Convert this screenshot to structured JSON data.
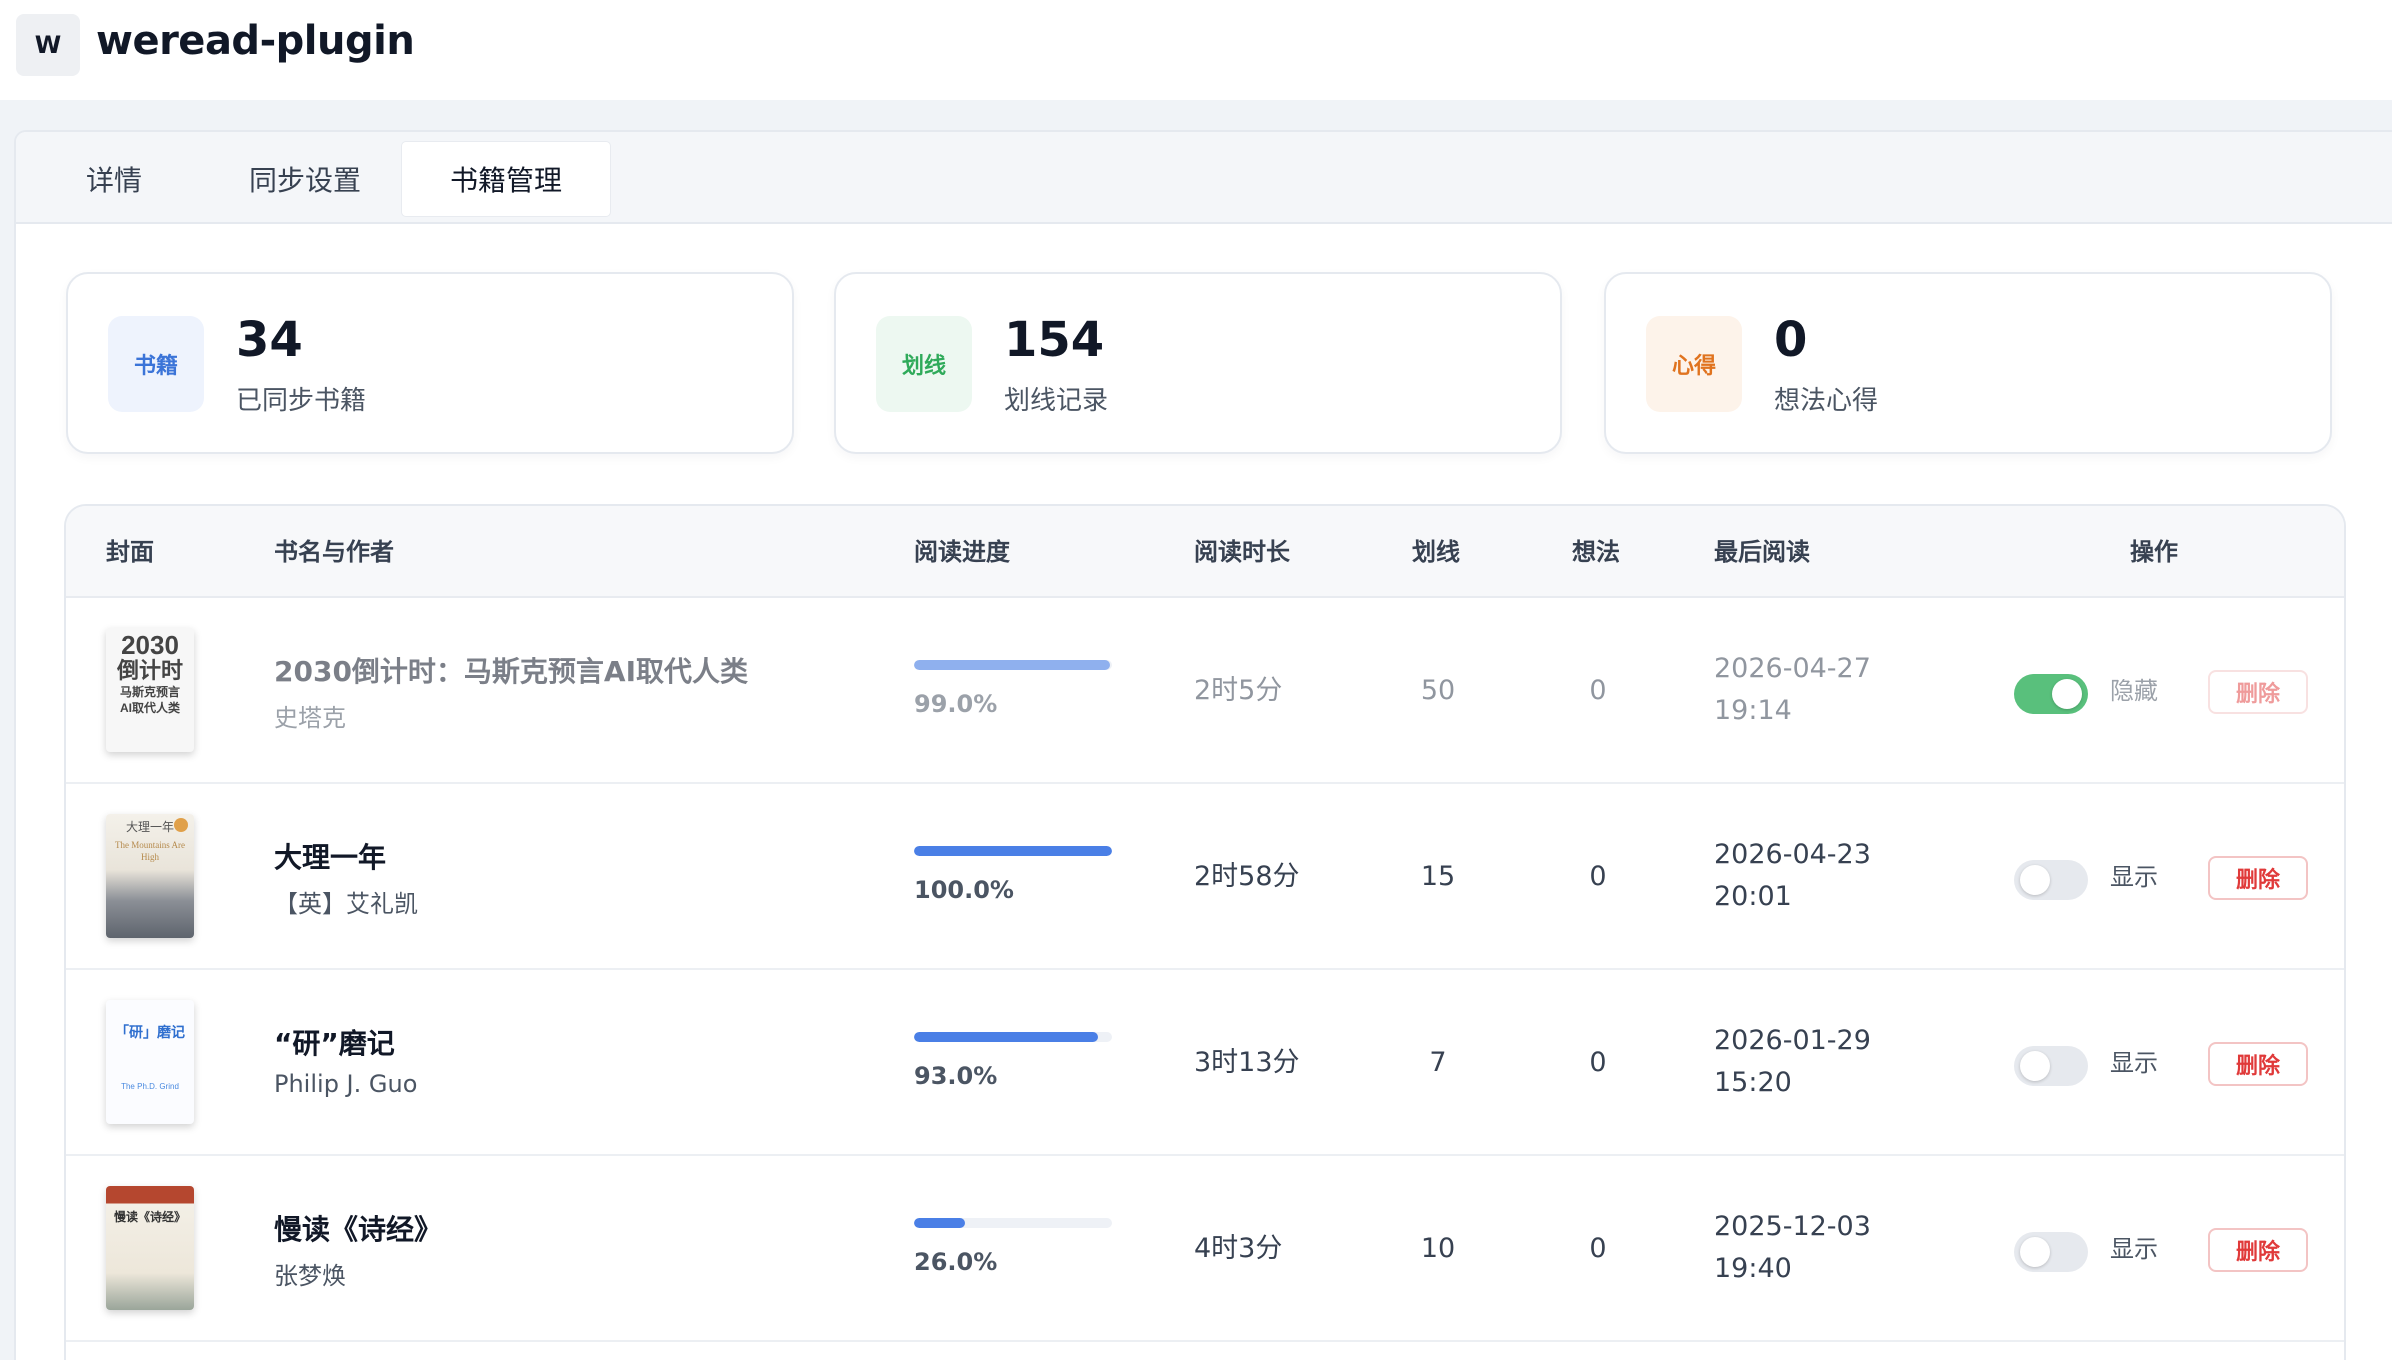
{
  "app": {
    "icon_letter": "W",
    "title": "weread-plugin"
  },
  "tabs": [
    {
      "label": "详情",
      "active": false
    },
    {
      "label": "同步设置",
      "active": false
    },
    {
      "label": "书籍管理",
      "active": true
    }
  ],
  "stats": [
    {
      "icon_text": "书籍",
      "value": "34",
      "label": "已同步书籍",
      "color": "#3b74d8",
      "bg": "#eef3fd"
    },
    {
      "icon_text": "划线",
      "value": "154",
      "label": "划线记录",
      "color": "#2faa5a",
      "bg": "#edf8f1"
    },
    {
      "icon_text": "心得",
      "value": "0",
      "label": "想法心得",
      "color": "#e0731f",
      "bg": "#fdf3ea"
    }
  ],
  "table": {
    "headers": {
      "cover": "封面",
      "title_author": "书名与作者",
      "progress": "阅读进度",
      "duration": "阅读时长",
      "highlights": "划线",
      "notes": "想法",
      "last_read": "最后阅读",
      "actions": "操作"
    },
    "rows": [
      {
        "title": "2030倒计时：马斯克预言AI取代人类",
        "author": "史塔克",
        "progress": 0.99,
        "progress_text": "99.0%",
        "duration": "2时5分",
        "highlights": "50",
        "notes": "0",
        "last_read_date": "2026-04-27",
        "last_read_time": "19:14",
        "visible_toggle_on": true,
        "toggle_label": "隐藏",
        "delete_label": "删除",
        "muted": true,
        "cover_lines": [
          "2030",
          "倒计时",
          "马斯克预言",
          "AI取代人类"
        ]
      },
      {
        "title": "大理一年",
        "author": "【英】艾礼凯",
        "progress": 1.0,
        "progress_text": "100.0%",
        "duration": "2时58分",
        "highlights": "15",
        "notes": "0",
        "last_read_date": "2026-04-23",
        "last_read_time": "20:01",
        "visible_toggle_on": false,
        "toggle_label": "显示",
        "delete_label": "删除",
        "muted": false,
        "cover_lines": [
          "大理一年",
          "The Mountains Are High"
        ]
      },
      {
        "title": "“研”磨记",
        "author": "Philip J. Guo",
        "progress": 0.93,
        "progress_text": "93.0%",
        "duration": "3时13分",
        "highlights": "7",
        "notes": "0",
        "last_read_date": "2026-01-29",
        "last_read_time": "15:20",
        "visible_toggle_on": false,
        "toggle_label": "显示",
        "delete_label": "删除",
        "muted": false,
        "cover_lines": [
          "「研」磨记",
          "The Ph.D. Grind"
        ]
      },
      {
        "title": "慢读《诗经》",
        "author": "张梦焕",
        "progress": 0.26,
        "progress_text": "26.0%",
        "duration": "4时3分",
        "highlights": "10",
        "notes": "0",
        "last_read_date": "2025-12-03",
        "last_read_time": "19:40",
        "visible_toggle_on": false,
        "toggle_label": "显示",
        "delete_label": "删除",
        "muted": false,
        "cover_lines": [
          "慢读《诗经》"
        ]
      }
    ]
  }
}
